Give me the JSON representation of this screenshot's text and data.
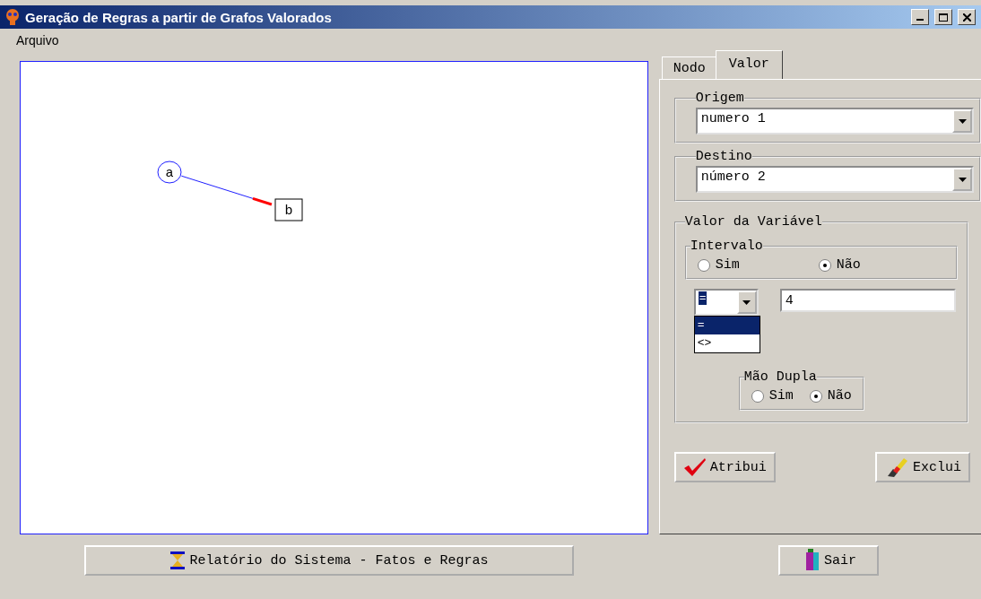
{
  "window": {
    "title": "Geração de Regras a partir de Grafos Valorados"
  },
  "menu": [
    {
      "label": "Arquivo"
    }
  ],
  "graph": {
    "nodes": [
      {
        "label": "a",
        "kind": "circle"
      },
      {
        "label": "b",
        "kind": "box"
      }
    ]
  },
  "tabs": [
    {
      "label": "Nodo",
      "selected": false
    },
    {
      "label": "Valor",
      "selected": true
    }
  ],
  "origem": {
    "label": "Origem",
    "value": "numero 1"
  },
  "destino": {
    "label": "Destino",
    "value": "número 2"
  },
  "valor": {
    "label": "Valor da Variável",
    "intervalo": {
      "label": "Intervalo",
      "options": [
        {
          "label": "Sim",
          "selected": false
        },
        {
          "label": "Não",
          "selected": true
        }
      ]
    },
    "operator": {
      "value": "=",
      "expanded": true,
      "options": [
        {
          "label": "=",
          "selected": true
        },
        {
          "label": "<>",
          "selected": false
        }
      ]
    },
    "input": "4",
    "mao_dupla": {
      "label": "Mão Dupla",
      "options": [
        {
          "label": "Sim",
          "selected": false
        },
        {
          "label": "Não",
          "selected": true
        }
      ]
    }
  },
  "buttons": [
    {
      "label": "Atribui",
      "kind": "check"
    },
    {
      "label": "Exclui",
      "kind": "eraser"
    }
  ],
  "footer": [
    {
      "label": "Relatório do Sistema - Fatos e Regras",
      "kind": "hourglass"
    },
    {
      "label": "Sair",
      "kind": "door"
    }
  ]
}
